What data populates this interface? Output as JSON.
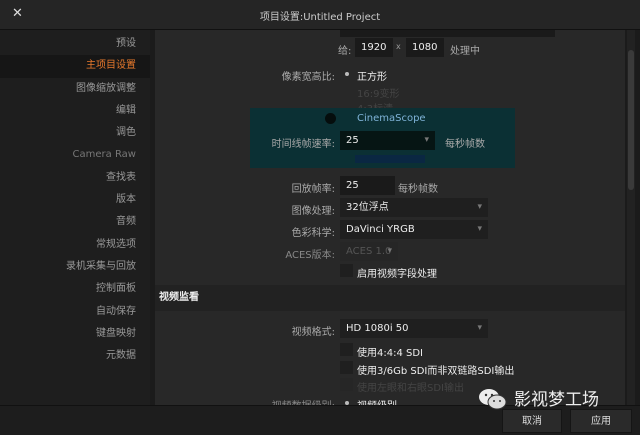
{
  "window": {
    "title": "项目设置:Untitled Project"
  },
  "sidebar": {
    "items": [
      "预设",
      "主项目设置",
      "图像缩放调整",
      "编辑",
      "调色",
      "Camera Raw",
      "查找表",
      "版本",
      "音频",
      "常规选项",
      "录机采集与回放",
      "控制面板",
      "自动保存",
      "键盘映射",
      "元数据"
    ],
    "active": 1
  },
  "main": {
    "res": {
      "prefix": "给:",
      "width": "1920",
      "x": "x",
      "height": "1080",
      "suffix": "处理中"
    },
    "aspect": {
      "label": "像素宽高比:",
      "options": [
        "正方形",
        "16:9变形",
        "4:3标清",
        "CinemaScope"
      ]
    },
    "timeline_rate": {
      "label": "时间线帧速率:",
      "value": "25",
      "unit": "每秒帧数"
    },
    "playback_rate": {
      "label": "回放帧率:",
      "value": "25",
      "unit": "每秒帧数"
    },
    "image_processing": {
      "label": "图像处理:",
      "value": "32位浮点"
    },
    "color_science": {
      "label": "色彩科学:",
      "value": "DaVinci YRGB"
    },
    "aces": {
      "label": "ACES版本:",
      "value": "ACES 1.0"
    },
    "field_processing": "启用视频字段处理",
    "monitor": {
      "section": "视频监看",
      "format_label": "视频格式:",
      "format_value": "HD 1080i 50",
      "opt1": "使用4:4:4 SDI",
      "opt2": "使用3/6Gb SDI而非双链路SDI输出",
      "opt3": "使用左眼和右眼SDI输出",
      "level_label": "视频数据级别:",
      "level_value": "视频级别"
    }
  },
  "footer": {
    "cancel": "取消",
    "apply": "应用"
  },
  "watermark": "影视梦工场",
  "colors": {
    "accent": "#e8792c",
    "highlight": "#0b3034"
  }
}
